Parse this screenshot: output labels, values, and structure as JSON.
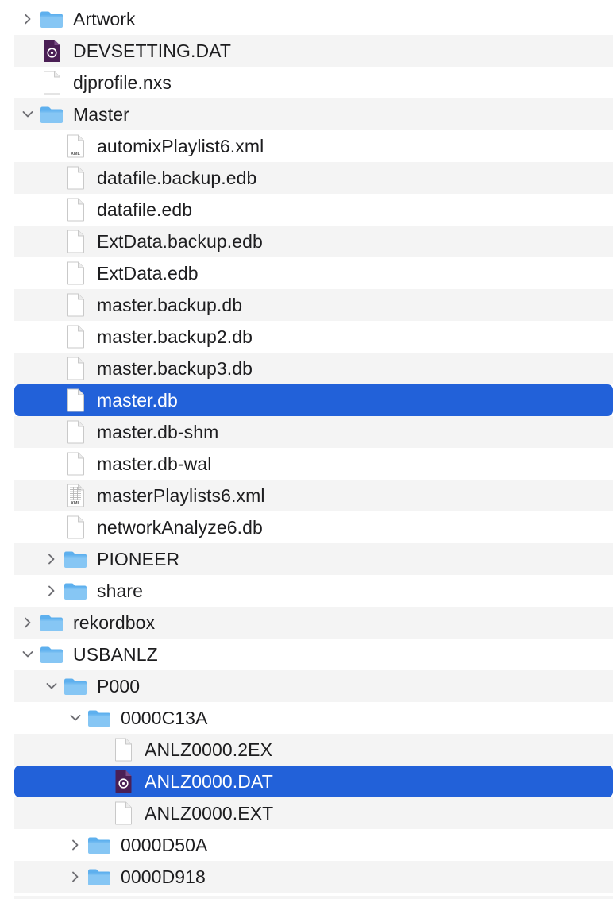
{
  "window": {
    "type": "finder-list-view"
  },
  "colors": {
    "selection": "#2261d9",
    "alt_row": "#f4f4f4",
    "folder": "#5eb0ee",
    "folder_tab": "#86c6f4",
    "dat_file": "#4a1f55"
  },
  "rows": [
    {
      "label": "Artwork",
      "level": 0,
      "kind": "folder",
      "expand": "collapsed",
      "selected": false
    },
    {
      "label": "DEVSETTING.DAT",
      "level": 0,
      "kind": "dat",
      "expand": "none",
      "selected": false
    },
    {
      "label": "djprofile.nxs",
      "level": 0,
      "kind": "doc",
      "expand": "none",
      "selected": false
    },
    {
      "label": "Master",
      "level": 0,
      "kind": "folder",
      "expand": "expanded",
      "selected": false
    },
    {
      "label": "automixPlaylist6.xml",
      "level": 1,
      "kind": "xml",
      "badge": "XML",
      "expand": "none",
      "selected": false
    },
    {
      "label": "datafile.backup.edb",
      "level": 1,
      "kind": "doc",
      "expand": "none",
      "selected": false
    },
    {
      "label": "datafile.edb",
      "level": 1,
      "kind": "doc",
      "expand": "none",
      "selected": false
    },
    {
      "label": "ExtData.backup.edb",
      "level": 1,
      "kind": "doc",
      "expand": "none",
      "selected": false
    },
    {
      "label": "ExtData.edb",
      "level": 1,
      "kind": "doc",
      "expand": "none",
      "selected": false
    },
    {
      "label": "master.backup.db",
      "level": 1,
      "kind": "doc",
      "expand": "none",
      "selected": false
    },
    {
      "label": "master.backup2.db",
      "level": 1,
      "kind": "doc",
      "expand": "none",
      "selected": false
    },
    {
      "label": "master.backup3.db",
      "level": 1,
      "kind": "doc",
      "expand": "none",
      "selected": false
    },
    {
      "label": "master.db",
      "level": 1,
      "kind": "doc",
      "expand": "none",
      "selected": true
    },
    {
      "label": "master.db-shm",
      "level": 1,
      "kind": "doc",
      "expand": "none",
      "selected": false
    },
    {
      "label": "master.db-wal",
      "level": 1,
      "kind": "doc",
      "expand": "none",
      "selected": false
    },
    {
      "label": "masterPlaylists6.xml",
      "level": 1,
      "kind": "xmlgrid",
      "badge": "XML",
      "expand": "none",
      "selected": false
    },
    {
      "label": "networkAnalyze6.db",
      "level": 1,
      "kind": "doc",
      "expand": "none",
      "selected": false
    },
    {
      "label": "PIONEER",
      "level": 1,
      "kind": "folder",
      "expand": "collapsed",
      "selected": false
    },
    {
      "label": "share",
      "level": 1,
      "kind": "folder",
      "expand": "collapsed",
      "selected": false
    },
    {
      "label": "rekordbox",
      "level": 0,
      "kind": "folder",
      "expand": "collapsed",
      "selected": false
    },
    {
      "label": "USBANLZ",
      "level": 0,
      "kind": "folder",
      "expand": "expanded",
      "selected": false
    },
    {
      "label": "P000",
      "level": 1,
      "kind": "folder",
      "expand": "expanded",
      "selected": false
    },
    {
      "label": "0000C13A",
      "level": 2,
      "kind": "folder",
      "expand": "expanded",
      "selected": false
    },
    {
      "label": "ANLZ0000.2EX",
      "level": 3,
      "kind": "doc",
      "expand": "none",
      "selected": false
    },
    {
      "label": "ANLZ0000.DAT",
      "level": 3,
      "kind": "dat",
      "expand": "none",
      "selected": true
    },
    {
      "label": "ANLZ0000.EXT",
      "level": 3,
      "kind": "doc",
      "expand": "none",
      "selected": false
    },
    {
      "label": "0000D50A",
      "level": 2,
      "kind": "folder",
      "expand": "collapsed",
      "selected": false
    },
    {
      "label": "0000D918",
      "level": 2,
      "kind": "folder",
      "expand": "collapsed",
      "selected": false
    }
  ]
}
